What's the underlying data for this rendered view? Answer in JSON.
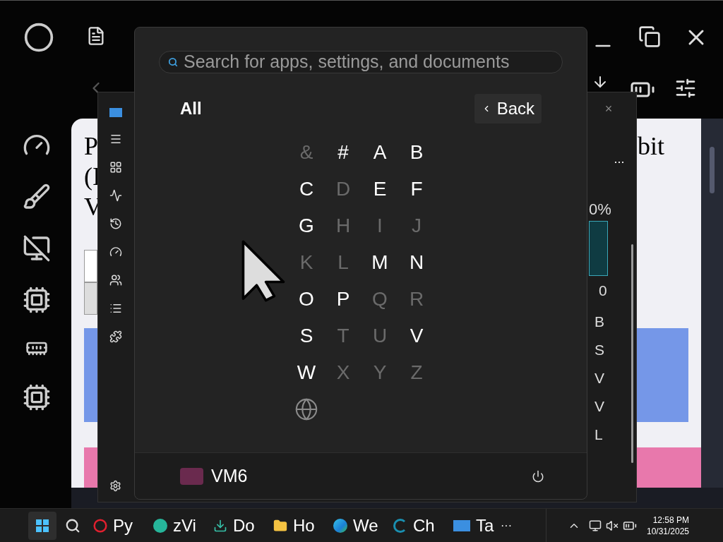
{
  "browser": {
    "page_text_left": [
      "P",
      "(I",
      "V"
    ],
    "page_text_right": "bit"
  },
  "task_manager": {
    "more_button": "...",
    "close": "×",
    "percent": "0%",
    "count": "0",
    "rows": [
      "B",
      "S",
      "V",
      "V",
      "L"
    ]
  },
  "start_menu": {
    "search": {
      "placeholder": "Search for apps, settings, and documents"
    },
    "title": "All",
    "back_button": "Back",
    "index": [
      {
        "kind": "letter",
        "label": "&",
        "disabled": true
      },
      {
        "kind": "letter",
        "label": "#",
        "disabled": false
      },
      {
        "kind": "letter",
        "label": "A",
        "disabled": false
      },
      {
        "kind": "letter",
        "label": "B",
        "disabled": false
      },
      {
        "kind": "letter",
        "label": "C",
        "disabled": false
      },
      {
        "kind": "letter",
        "label": "D",
        "disabled": true
      },
      {
        "kind": "letter",
        "label": "E",
        "disabled": false
      },
      {
        "kind": "letter",
        "label": "F",
        "disabled": false
      },
      {
        "kind": "letter",
        "label": "G",
        "disabled": false
      },
      {
        "kind": "letter",
        "label": "H",
        "disabled": true
      },
      {
        "kind": "letter",
        "label": "I",
        "disabled": true
      },
      {
        "kind": "letter",
        "label": "J",
        "disabled": true
      },
      {
        "kind": "letter",
        "label": "K",
        "disabled": true
      },
      {
        "kind": "letter",
        "label": "L",
        "disabled": true
      },
      {
        "kind": "letter",
        "label": "M",
        "disabled": false
      },
      {
        "kind": "letter",
        "label": "N",
        "disabled": false
      },
      {
        "kind": "letter",
        "label": "O",
        "disabled": false
      },
      {
        "kind": "letter",
        "label": "P",
        "disabled": false
      },
      {
        "kind": "letter",
        "label": "Q",
        "disabled": true
      },
      {
        "kind": "letter",
        "label": "R",
        "disabled": true
      },
      {
        "kind": "letter",
        "label": "S",
        "disabled": false
      },
      {
        "kind": "letter",
        "label": "T",
        "disabled": true
      },
      {
        "kind": "letter",
        "label": "U",
        "disabled": true
      },
      {
        "kind": "letter",
        "label": "V",
        "disabled": false
      },
      {
        "kind": "letter",
        "label": "W",
        "disabled": false
      },
      {
        "kind": "letter",
        "label": "X",
        "disabled": true
      },
      {
        "kind": "letter",
        "label": "Y",
        "disabled": true
      },
      {
        "kind": "letter",
        "label": "Z",
        "disabled": true
      },
      {
        "kind": "globe",
        "disabled": true
      }
    ],
    "user": "VM6"
  },
  "taskbar": {
    "apps": [
      {
        "label": "Py"
      },
      {
        "label": "zVi"
      },
      {
        "label": "Do"
      },
      {
        "label": "Ho"
      },
      {
        "label": "We"
      },
      {
        "label": "Ch"
      },
      {
        "label": "Ta"
      }
    ],
    "overflow": "···",
    "time": "12:58 PM",
    "date": "10/31/2025"
  }
}
